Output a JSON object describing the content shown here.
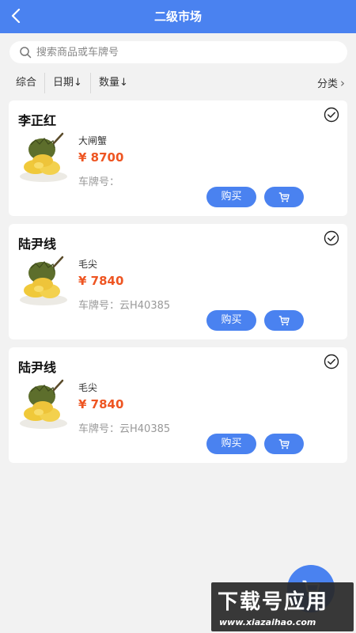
{
  "header": {
    "title": "二级市场",
    "back_icon": "chevron-left-icon"
  },
  "search": {
    "placeholder": "搜索商品或车牌号",
    "value": ""
  },
  "filters": {
    "items": [
      {
        "label": "综合"
      },
      {
        "label": "日期",
        "arrow": "↓"
      },
      {
        "label": "数量",
        "arrow": "↓"
      }
    ],
    "category": {
      "label": "分类",
      "arrow": "›"
    }
  },
  "cards": [
    {
      "owner": "李正红",
      "product": "大闸蟹",
      "price": "¥ 8700",
      "plate": "车牌号：",
      "buy_label": "购买"
    },
    {
      "owner": "陆尹线",
      "product": "毛尖",
      "price": "¥ 7840",
      "plate": "车牌号：云H40385",
      "buy_label": "购买"
    },
    {
      "owner": "陆尹线",
      "product": "毛尖",
      "price": "¥ 7840",
      "plate": "车牌号：云H40385",
      "buy_label": "购买"
    }
  ],
  "watermark": {
    "main": "下载号应用",
    "url": "www.xiazaihao.com"
  },
  "colors": {
    "primary": "#4a82f0",
    "price": "#ee5522",
    "background": "#f2f2f2"
  }
}
